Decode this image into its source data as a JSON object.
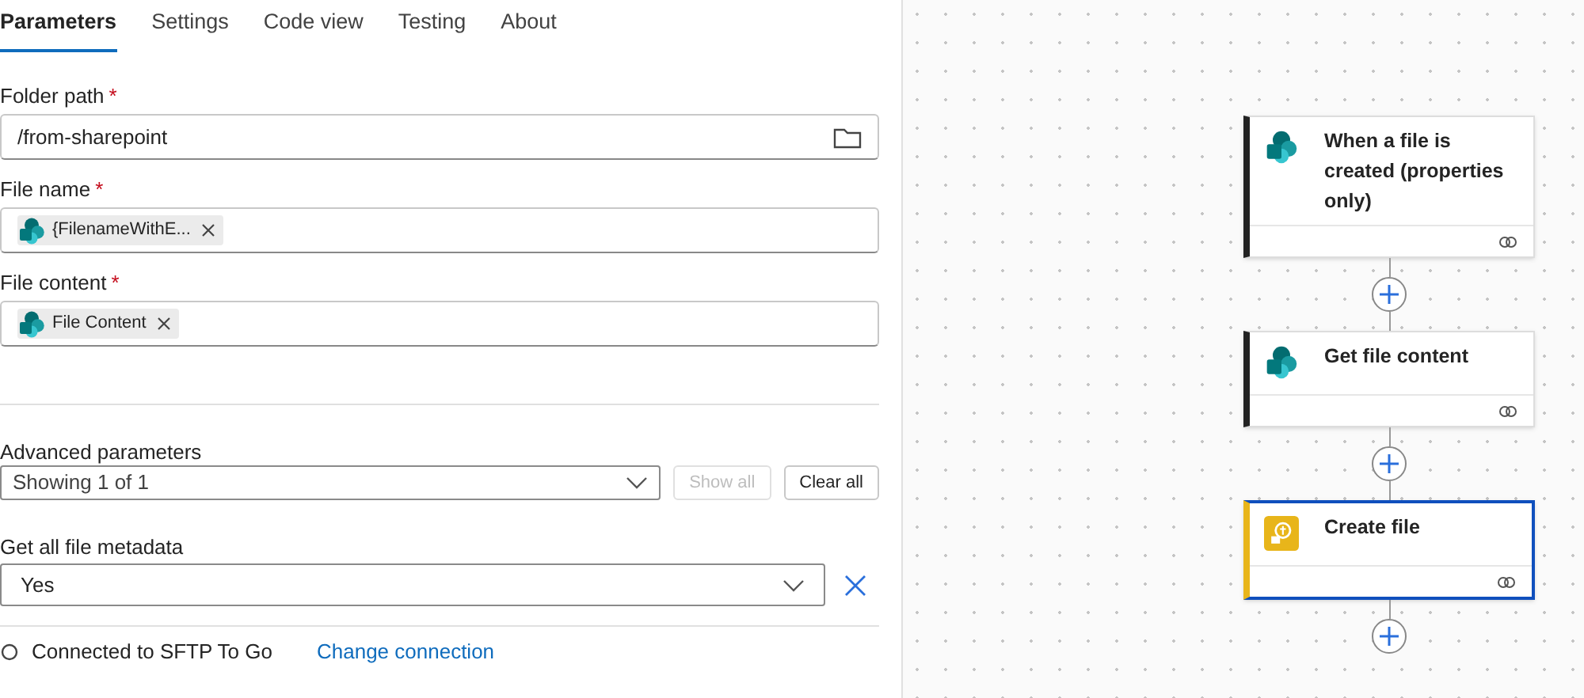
{
  "tabs": [
    {
      "label": "Parameters",
      "selected": true
    },
    {
      "label": "Settings",
      "selected": false
    },
    {
      "label": "Code view",
      "selected": false
    },
    {
      "label": "Testing",
      "selected": false
    },
    {
      "label": "About",
      "selected": false
    }
  ],
  "fields": [
    {
      "kind": "text",
      "label": "Folder path",
      "required": "*",
      "value": "/from-sharepoint"
    },
    {
      "kind": "tokens",
      "label": "File name",
      "required": "*",
      "tokens": [
        "{FilenameWithE..."
      ]
    },
    {
      "kind": "tokens",
      "label": "File content",
      "required": "*",
      "tokens": [
        "File Content"
      ]
    }
  ],
  "advanced": {
    "label": "Advanced parameters",
    "value": "Showing 1 of 1",
    "buttons": [
      {
        "label": "Show all",
        "disabled": true
      },
      {
        "label": "Clear all",
        "disabled": false
      }
    ]
  },
  "metadata": {
    "label": "Get all file metadata",
    "value": "Yes"
  },
  "connection": {
    "text": "Connected to SFTP To Go",
    "link": "Change connection"
  },
  "flow": [
    {
      "kind": "sharepoint",
      "title": "When a file is created (properties only)",
      "selected": false
    },
    {
      "kind": "sharepoint",
      "title": "Get file content",
      "selected": false
    },
    {
      "kind": "sftp",
      "title": "Create file",
      "selected": true
    }
  ]
}
